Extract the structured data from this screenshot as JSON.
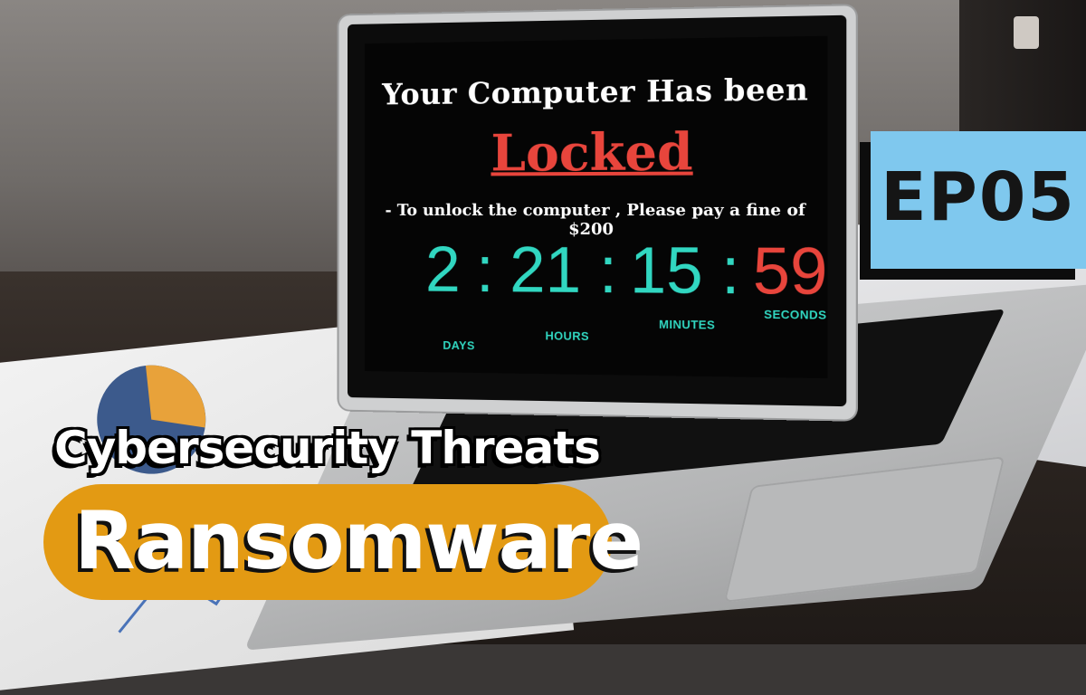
{
  "screen": {
    "title": "Your Computer Has been",
    "headline": "Locked",
    "message": "- To unlock the computer , Please pay a fine of $200",
    "timer": {
      "days": "2",
      "hours": "21",
      "minutes": "15",
      "seconds": "59",
      "separator": ":",
      "labels": {
        "days": "DAYS",
        "hours": "HOURS",
        "minutes": "MINUTES",
        "seconds": "SECONDS"
      }
    }
  },
  "overlay": {
    "episode": "EP05",
    "subtitle": "Cybersecurity Threats",
    "title": "Ransomware"
  },
  "colors": {
    "timer": "#31d7c1",
    "seconds": "#e8453c",
    "locked": "#e8453c",
    "episode_box": "#7fc8ee",
    "title_pill": "#e39a13"
  }
}
